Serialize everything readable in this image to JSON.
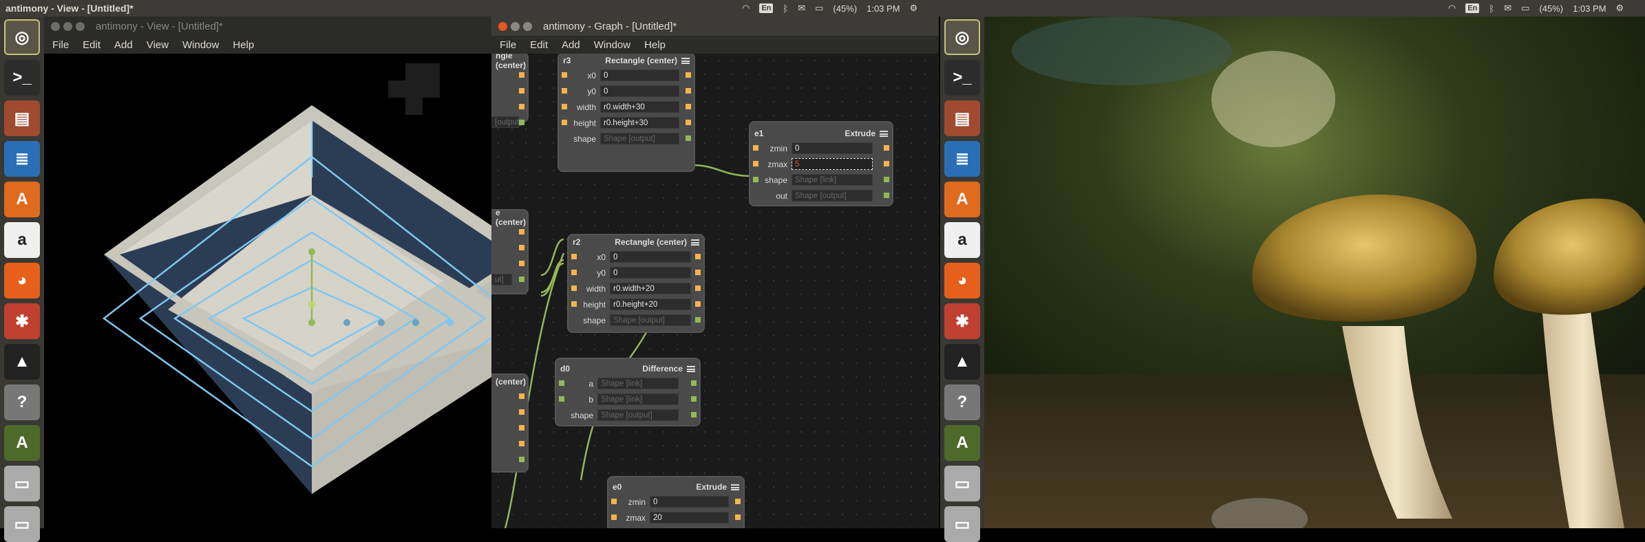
{
  "left_screen": {
    "panel_title": "antimony - View - [Untitled]*",
    "tray": {
      "lang": "En",
      "battery": "(45%)",
      "time": "1:03 PM"
    }
  },
  "right_screen": {
    "tray": {
      "lang": "En",
      "battery": "(45%)",
      "time": "1:03 PM"
    }
  },
  "launcher_icons": [
    "ubuntu-dash-icon",
    "terminal-icon",
    "files-icon",
    "writer-icon",
    "software-center-icon",
    "amazon-icon",
    "firefox-icon",
    "settings-icon",
    "inkscape-icon",
    "help-icon",
    "antimony-icon",
    "drive-icon",
    "drive-icon-2"
  ],
  "view_window": {
    "title": "antimony - View - [Untitled]*",
    "menu": [
      "File",
      "Edit",
      "Add",
      "View",
      "Window",
      "Help"
    ]
  },
  "graph_window": {
    "title": "antimony - Graph - [Untitled]*",
    "menu": [
      "File",
      "Edit",
      "Add",
      "Window",
      "Help"
    ],
    "nodes": {
      "r3": {
        "name": "r3",
        "type": "Rectangle (center)",
        "rows": [
          {
            "label": "x0",
            "value": "0"
          },
          {
            "label": "y0",
            "value": "0"
          },
          {
            "label": "width",
            "value": "r0.width+30"
          },
          {
            "label": "height",
            "value": "r0.height+30"
          },
          {
            "label": "shape",
            "value": "Shape [output]"
          }
        ]
      },
      "e1": {
        "name": "e1",
        "type": "Extrude",
        "rows": [
          {
            "label": "zmin",
            "value": "0"
          },
          {
            "label": "zmax",
            "value": "5"
          },
          {
            "label": "shape",
            "value": "Shape [link]"
          },
          {
            "label": "out",
            "value": "Shape [output]"
          }
        ]
      },
      "r2": {
        "name": "r2",
        "type": "Rectangle (center)",
        "rows": [
          {
            "label": "x0",
            "value": "0"
          },
          {
            "label": "y0",
            "value": "0"
          },
          {
            "label": "width",
            "value": "r0.width+20"
          },
          {
            "label": "height",
            "value": "r0.height+20"
          },
          {
            "label": "shape",
            "value": "Shape [output]"
          }
        ]
      },
      "d0": {
        "name": "d0",
        "type": "Difference",
        "rows": [
          {
            "label": "a",
            "value": "Shape [link]"
          },
          {
            "label": "b",
            "value": "Shape [link]"
          },
          {
            "label": "shape",
            "value": "Shape [output]"
          }
        ]
      },
      "e0": {
        "name": "e0",
        "type": "Extrude",
        "rows": [
          {
            "label": "zmin",
            "value": "0"
          },
          {
            "label": "zmax",
            "value": "20"
          }
        ]
      },
      "partial_a": {
        "type": "ngle (center)",
        "last": "[output]"
      },
      "partial_b": {
        "type": "e (center)",
        "last": "ut]"
      },
      "partial_c": {
        "type": "(center)"
      }
    }
  },
  "colors": {
    "panel": "#3c3b37",
    "accent": "#e95420",
    "pin_value": "#f5b34b",
    "pin_shape": "#93b857",
    "wire": "#93b857",
    "wireframe": "#7fc8f0"
  }
}
